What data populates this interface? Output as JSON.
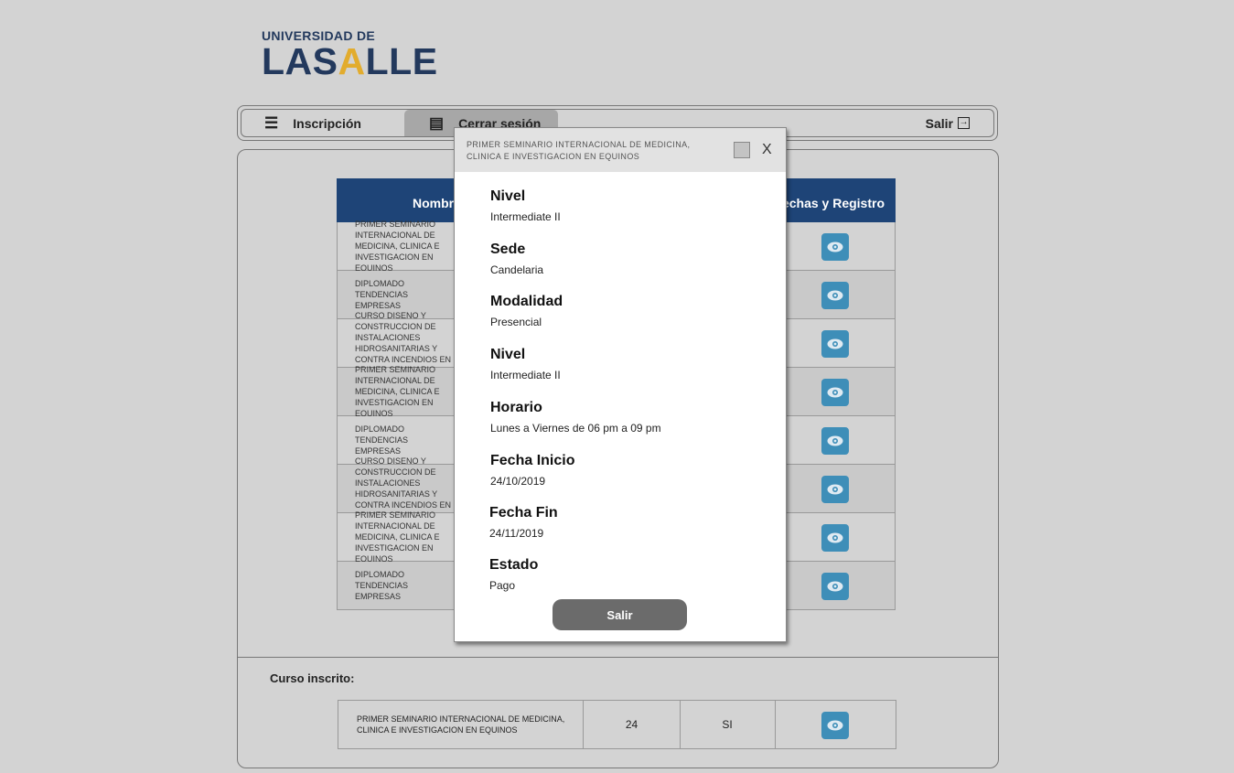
{
  "logo": {
    "top": "UNIVERSIDAD DE",
    "main_a": "LAS",
    "main_accent": "A",
    "main_b": "LLE"
  },
  "nav": {
    "inscripcion": "Inscripción",
    "cerrar_sesion": "Cerrar sesión",
    "salir": "Salir"
  },
  "table": {
    "headers": {
      "nombre": "Nombre",
      "fechas": "Fechas y Registro"
    },
    "rows": [
      {
        "name": "PRIMER SEMINARIO INTERNACIONAL DE MEDICINA, CLINICA E INVESTIGACION EN EQUINOS"
      },
      {
        "name": "DIPLOMADO TENDENCIAS EMPRESAS"
      },
      {
        "name": "CURSO DISENO Y CONSTRUCCION DE INSTALACIONES HIDROSANITARIAS Y CONTRA INCENDIOS EN EDIFICACIONES"
      },
      {
        "name": "PRIMER SEMINARIO INTERNACIONAL DE MEDICINA, CLINICA E INVESTIGACION EN EQUINOS"
      },
      {
        "name": "DIPLOMADO TENDENCIAS EMPRESAS"
      },
      {
        "name": "CURSO DISENO Y CONSTRUCCION DE INSTALACIONES HIDROSANITARIAS Y CONTRA INCENDIOS EN EDIFICACIONES"
      },
      {
        "name": "PRIMER SEMINARIO INTERNACIONAL DE MEDICINA, CLINICA E INVESTIGACION EN EQUINOS"
      },
      {
        "name": "DIPLOMADO TENDENCIAS EMPRESAS"
      }
    ]
  },
  "enrolled": {
    "label": "Curso inscrito:",
    "name": "PRIMER SEMINARIO INTERNACIONAL DE MEDICINA, CLINICA E INVESTIGACION EN EQUINOS",
    "col2": "24",
    "col3": "SI"
  },
  "modal": {
    "title": "PRIMER SEMINARIO INTERNACIONAL DE MEDICINA, CLINICA E INVESTIGACION EN EQUINOS",
    "close": "X",
    "fields": [
      {
        "label": "Nivel",
        "value": "Intermediate II"
      },
      {
        "label": "Sede",
        "value": "Candelaria"
      },
      {
        "label": "Modalidad",
        "value": "Presencial"
      },
      {
        "label": "Nivel",
        "value": "Intermediate II"
      },
      {
        "label": "Horario",
        "value": "Lunes a Viernes de 06 pm a 09 pm"
      },
      {
        "label": "Fecha Inicio",
        "value": "24/10/2019"
      },
      {
        "label": "Fecha Fin",
        "value": "24/11/2019"
      },
      {
        "label": "Estado",
        "value": "Pago"
      }
    ],
    "salir": "Salir"
  },
  "colors": {
    "header_blue": "#1e4477",
    "eye_button": "#3e8eb8",
    "logo_navy": "#23395d",
    "logo_gold": "#e2ac2e"
  }
}
